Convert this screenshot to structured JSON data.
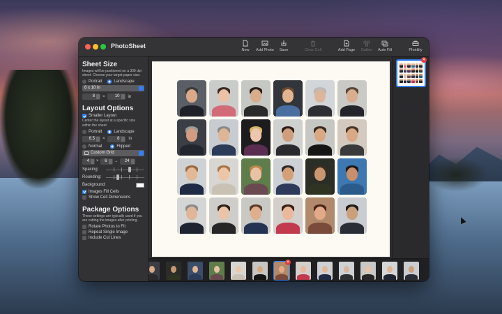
{
  "app": {
    "title": "PhotoSheet"
  },
  "toolbar": {
    "new": "New",
    "add_photo": "Add Photo",
    "save": "Save",
    "clear_cell": "Clear Cell",
    "add_page": "Add Page",
    "gather": "Gather",
    "auto_fill": "Auto Fill",
    "photility": "Photility"
  },
  "sheet_size": {
    "title": "Sheet Size",
    "desc": "Images will be positioned on a 300 dpi sheet. Choose your target paper size.",
    "portrait": "Portrait",
    "landscape": "Landscape",
    "paper": "8 x 10 in",
    "width": "8",
    "times": "×",
    "height": "10",
    "unit": "in"
  },
  "layout": {
    "title": "Layout Options",
    "smaller_layout": "Smaller Layout",
    "desc": "Center the layout at a specific size within the sheet.",
    "portrait": "Portrait",
    "landscape": "Landscape",
    "width": "6.5",
    "times": "×",
    "height": "8",
    "unit": "in",
    "normal": "Normal",
    "flipped": "Flipped",
    "grid_type": "Custom Grid",
    "cols": "4",
    "rows": "6",
    "arrow": "→",
    "total": "24",
    "spacing": "Spacing:",
    "rounding": "Rounding:",
    "background": "Background:",
    "images_fill": "Images Fill Cells",
    "show_dims": "Show Cell Dimensions"
  },
  "package": {
    "title": "Package Options",
    "desc": "These settings are typically used if you are cutting the images after printing.",
    "rotate": "Rotate Photos to Fit",
    "repeat": "Repeat Single Image",
    "cut_lines": "Include Cut Lines"
  },
  "colors": {
    "accent": "#2f7ff7",
    "sheet": "#fdfaf4",
    "close": "#e83a3a"
  },
  "photos": [
    {
      "bg": "#5a5f66",
      "skin": "#d9a98a",
      "hair": "#3a3a3a",
      "suit": "#1e2228"
    },
    {
      "bg": "#c9ccc9",
      "skin": "#e9c2a8",
      "hair": "#3b2a22",
      "suit": "#d36a78"
    },
    {
      "bg": "#c6c8c4",
      "skin": "#d7ad8b",
      "hair": "#2a1f1a",
      "suit": "#2a2a2a"
    },
    {
      "bg": "#32353b",
      "skin": "#e2b592",
      "hair": "#6a4a2e",
      "suit": "#4a6ea0"
    },
    {
      "bg": "#d2d6d8",
      "skin": "#dcb59d",
      "hair": "#b8b8b8",
      "suit": "#2d2f33"
    },
    {
      "bg": "#c9c9c6",
      "skin": "#d9ad90",
      "hair": "#5a4636",
      "suit": "#23252a"
    },
    {
      "bg": "#3b3e44",
      "skin": "#d29c82",
      "hair": "#9a9a9a",
      "suit": "#22262e"
    },
    {
      "bg": "#c8ccd0",
      "skin": "#dfb597",
      "hair": "#8a8a8a",
      "suit": "#2b3b58"
    },
    {
      "bg": "#1c1c1c",
      "skin": "#ecc7ad",
      "hair": "#d6b46a",
      "suit": "#5a2e50"
    },
    {
      "bg": "#cfd1cf",
      "skin": "#cf9e7f",
      "hair": "#2e1f18",
      "suit": "#2a2a2e"
    },
    {
      "bg": "#c6c7c3",
      "skin": "#d8a984",
      "hair": "#3a2a1e",
      "suit": "#151515"
    },
    {
      "bg": "#d3c9be",
      "skin": "#d9a884",
      "hair": "#4a3626",
      "suit": "#3a3a3a"
    },
    {
      "bg": "#cfd2d4",
      "skin": "#e3b896",
      "hair": "#9a6a40",
      "suit": "#1f2a44"
    },
    {
      "bg": "#d8d6d2",
      "skin": "#ecc6a8",
      "hair": "#a8764a",
      "suit": "#c9c2b4"
    },
    {
      "bg": "#5e7d4a",
      "skin": "#e8c2a2",
      "hair": "#b8884a",
      "suit": "#6a4a50"
    },
    {
      "bg": "#cdd0d4",
      "skin": "#d4a078",
      "hair": "#2a2a2a",
      "suit": "#2d3a5a"
    },
    {
      "bg": "#2b2e26",
      "skin": "#c99672",
      "hair": "#3b2e1f",
      "suit": "#2e3322"
    },
    {
      "bg": "#3e78b0",
      "skin": "#c88f6a",
      "hair": "#1a1a1a",
      "suit": "#2a5b8a"
    },
    {
      "bg": "#d4d6d6",
      "skin": "#dfb699",
      "hair": "#8a8a8a",
      "suit": "#1e2430"
    },
    {
      "bg": "#cfcdca",
      "skin": "#eac4a8",
      "hair": "#2e2018",
      "suit": "#262626"
    },
    {
      "bg": "#c8c9c5",
      "skin": "#deaf8e",
      "hair": "#5a3e28",
      "suit": "#253352"
    },
    {
      "bg": "#d3cfca",
      "skin": "#eab99c",
      "hair": "#3a1e16",
      "suit": "#c13a4e"
    },
    {
      "bg": "#b08a6a",
      "skin": "#e2aa88",
      "hair": "#4a2418",
      "suit": "#7a4a3a"
    },
    {
      "bg": "#c9ccd0",
      "skin": "#caa07c",
      "hair": "#1e1a18",
      "suit": "#2a2d35"
    }
  ],
  "strip": [
    {
      "bg": "#3a3e44",
      "skin": "#d9a98a",
      "suit": "#2a2a2a"
    },
    {
      "bg": "#2a2c2a",
      "skin": "#c99672",
      "suit": "#2e3322"
    },
    {
      "bg": "#3a4e6a",
      "skin": "#e2b592",
      "suit": "#2b3b58"
    },
    {
      "bg": "#5e7d4a",
      "skin": "#e8c2a2",
      "suit": "#6a4a50"
    },
    {
      "bg": "#d8d6d2",
      "skin": "#ecc6a8",
      "suit": "#c9c2b4"
    },
    {
      "bg": "#c6c7c3",
      "skin": "#d8a984",
      "suit": "#151515"
    },
    {
      "bg": "#b08a6a",
      "skin": "#e2aa88",
      "suit": "#7a4a3a"
    },
    {
      "bg": "#d3cfca",
      "skin": "#eab99c",
      "suit": "#c13a4e"
    },
    {
      "bg": "#cdd0d4",
      "skin": "#e3b896",
      "suit": "#1f2a44"
    },
    {
      "bg": "#cfd2d4",
      "skin": "#dcb59d",
      "suit": "#2d2f33"
    },
    {
      "bg": "#c9c9c6",
      "skin": "#eac4a8",
      "suit": "#262626"
    },
    {
      "bg": "#d4d6d6",
      "skin": "#dfb699",
      "suit": "#1e2430"
    },
    {
      "bg": "#c9ccd0",
      "skin": "#caa07c",
      "suit": "#2a2d35"
    }
  ]
}
